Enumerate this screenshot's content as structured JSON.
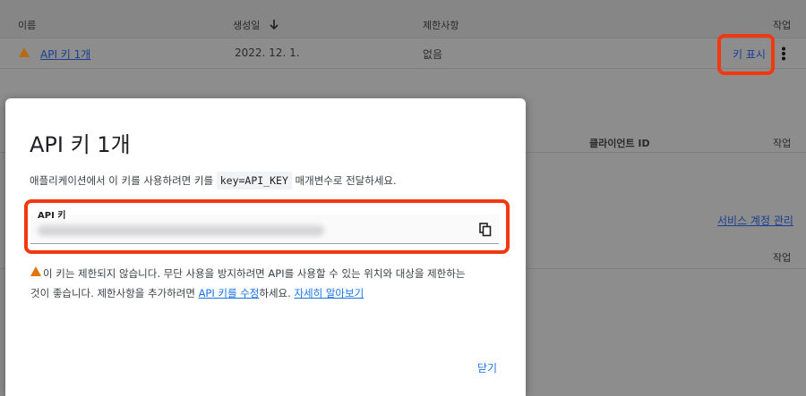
{
  "table": {
    "headers": {
      "name": "이름",
      "created": "생성일",
      "restrictions": "제한사항",
      "actions": "작업"
    },
    "row": {
      "name": "API 키 1개",
      "created": "2022. 12. 1.",
      "restrictions": "없음",
      "action": "키 표시"
    }
  },
  "section2": {
    "client_id": "클라이언트 ID",
    "actions": "작업"
  },
  "section3": {
    "manage_link": "서비스 계정 관리",
    "actions": "작업"
  },
  "dialog": {
    "title": "API 키 1개",
    "desc_before": "애플리케이션에서 이 키를 사용하려면 키를 ",
    "desc_code": "key=API_KEY",
    "desc_after": " 매개변수로 전달하세요.",
    "field_label": "API 키",
    "warning_line1": "이 키는 제한되지 않습니다. 무단 사용을 방지하려면 API를 사용할 수 있는 위치와 대상을 제한하는",
    "warning_line2_prefix": "것이 좋습니다. 제한사항을 추가하려면 ",
    "warning_link1": "API 키를 수정",
    "warning_mid": "하세요. ",
    "warning_link2": "자세히 알아보기",
    "close": "닫기"
  },
  "colors": {
    "accent": "#1a73e8",
    "warning": "#e37400",
    "highlight": "#f2380e"
  }
}
